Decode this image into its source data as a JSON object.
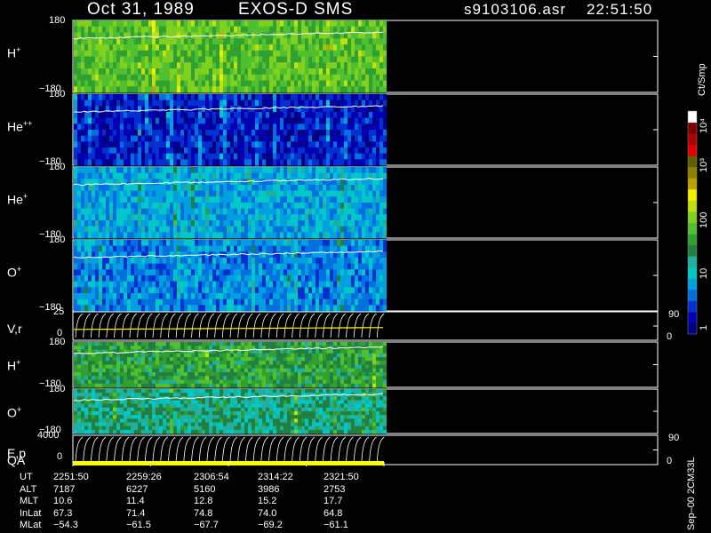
{
  "header": {
    "date": "Oct 31, 1989",
    "instrument": "EXOS-D SMS",
    "file": "s9103106.asr",
    "time": "22:51:50"
  },
  "panels": [
    {
      "id": "hplus",
      "label": "H",
      "sup": "+",
      "ytop": "180",
      "ybottom": "−180",
      "type": "spectrogram",
      "level": 0.6
    },
    {
      "id": "hepp",
      "label": "He",
      "sup": "++",
      "ytop": "180",
      "ybottom": "−180",
      "type": "spectrogram",
      "level": 0.05
    },
    {
      "id": "heplus",
      "label": "He",
      "sup": "+",
      "ytop": "180",
      "ybottom": "−180",
      "type": "spectrogram",
      "level": 0.25
    },
    {
      "id": "oplus",
      "label": "O",
      "sup": "+",
      "ytop": "180",
      "ybottom": "−180",
      "type": "spectrogram",
      "level": 0.2
    },
    {
      "id": "vr",
      "label": "V,r",
      "sup": "",
      "ytop": "25",
      "ymid": "0",
      "rtop": "90",
      "rbottom": "0",
      "type": "lines"
    },
    {
      "id": "hplus2",
      "label": "H",
      "sup": "+",
      "ytop": "180",
      "ybottom": "−180",
      "type": "spectrogram",
      "level": 0.5
    },
    {
      "id": "oplus2",
      "label": "O",
      "sup": "+",
      "ytop": "180",
      "ybottom": "−180",
      "type": "spectrogram",
      "level": 0.4
    },
    {
      "id": "ep",
      "label": "E,p",
      "label2": "QA",
      "sup": "",
      "ytop": "4000",
      "ymid": "0",
      "rtop": "90",
      "rbottom": "0",
      "type": "lines"
    }
  ],
  "colorbar": {
    "unit": "Ct/Smp",
    "labels": [
      "10⁴",
      "10³",
      "100",
      "10",
      "1"
    ],
    "colors": [
      "#000080",
      "#0000b0",
      "#0030d0",
      "#0070e0",
      "#00a0e0",
      "#00c8c8",
      "#20b0a0",
      "#208040",
      "#30a030",
      "#50c030",
      "#80d020",
      "#c0e010",
      "#f0f000",
      "#c0a000",
      "#908000",
      "#606000",
      "#e00000",
      "#b00000",
      "#800000",
      "#ffffff"
    ]
  },
  "footer": {
    "rows": [
      {
        "label": "UT",
        "values": [
          "2251:50",
          "2259:26",
          "2306:54",
          "2314:22",
          "2321:50"
        ]
      },
      {
        "label": "ALT",
        "values": [
          "7187",
          "6227",
          "5160",
          "3986",
          "2753"
        ]
      },
      {
        "label": "MLT",
        "values": [
          "10.6",
          "11.4",
          "12.8",
          "15.2",
          "17.7"
        ]
      },
      {
        "label": "InLat",
        "values": [
          "67.3",
          "71.4",
          "74.8",
          "74.0",
          "64.8"
        ]
      },
      {
        "label": "MLat",
        "values": [
          "−54.3",
          "−61.5",
          "−67.7",
          "−69.2",
          "−61.1"
        ]
      }
    ],
    "version": "Sep–00 2CM33L"
  }
}
